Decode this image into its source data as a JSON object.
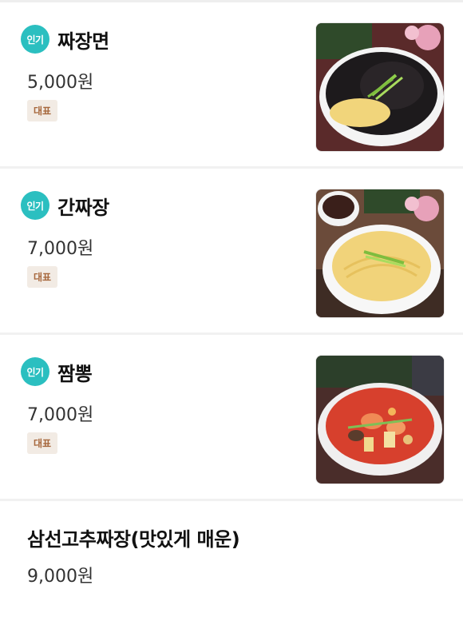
{
  "menu": {
    "items": [
      {
        "badge": "인기",
        "name": "짜장면",
        "price": "5,000원",
        "tag": "대표"
      },
      {
        "badge": "인기",
        "name": "간짜장",
        "price": "7,000원",
        "tag": "대표"
      },
      {
        "badge": "인기",
        "name": "짬뽕",
        "price": "7,000원",
        "tag": "대표"
      },
      {
        "name": "삼선고추짜장(맛있게 매운)",
        "price": "9,000원"
      }
    ]
  },
  "colors": {
    "badge_bg": "#2bbfc0",
    "tag_bg": "#f2ebe4",
    "tag_text": "#a7683d"
  }
}
